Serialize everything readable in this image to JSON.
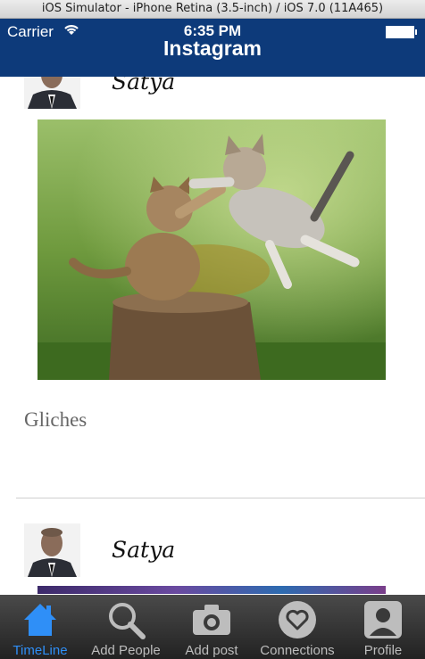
{
  "simulator": {
    "title": "iOS Simulator - iPhone Retina (3.5-inch) / iOS 7.0 (11A465)"
  },
  "status_bar": {
    "carrier": "Carrier",
    "time": "6:35 PM"
  },
  "nav": {
    "title": "Instagram"
  },
  "posts": [
    {
      "username": "Satya",
      "caption": "Gliches"
    },
    {
      "username": "Satya"
    }
  ],
  "tabs": [
    {
      "label": "TimeLine",
      "icon": "home-icon",
      "active": true
    },
    {
      "label": "Add People",
      "icon": "search-icon"
    },
    {
      "label": "Add post",
      "icon": "camera-icon"
    },
    {
      "label": "Connections",
      "icon": "heart-icon"
    },
    {
      "label": "Profile",
      "icon": "person-icon"
    }
  ],
  "colors": {
    "nav": "#0d3a7a",
    "active_tab": "#2f8ff7",
    "inactive_tab": "#bdbdbd"
  }
}
